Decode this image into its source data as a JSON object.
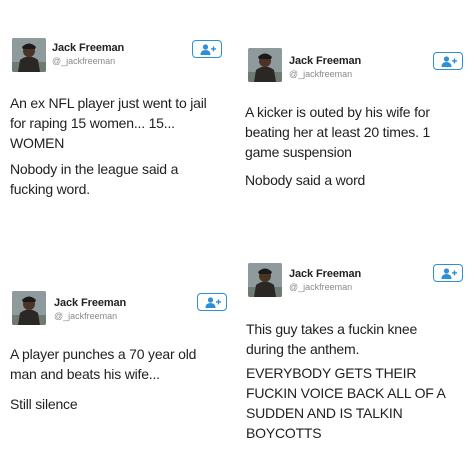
{
  "tweets": [
    {
      "name": "Jack Freeman",
      "handle": "@_jackfreeman",
      "paragraphs": [
        "An ex NFL player just went to jail\nfor raping 15 women... 15...\nWOMEN",
        "Nobody in the league said a\nfucking word."
      ]
    },
    {
      "name": "Jack Freeman",
      "handle": "@_jackfreeman",
      "paragraphs": [
        "A kicker is outed by his wife for\nbeating her at least 20 times. 1\ngame suspension",
        "Nobody said a word"
      ]
    },
    {
      "name": "Jack Freeman",
      "handle": "@_jackfreeman",
      "paragraphs": [
        "A player punches a 70 year old\nman and beats his wife...",
        "Still silence"
      ]
    },
    {
      "name": "Jack Freeman",
      "handle": "@_jackfreeman",
      "paragraphs": [
        "This guy takes a fuckin knee\nduring the anthem.",
        "EVERYBODY GETS THEIR\nFUCKIN VOICE BACK ALL OF A\nSUDDEN AND IS TALKIN\nBOYCOTTS"
      ]
    }
  ],
  "icons": {
    "follow": "add-user-icon",
    "avatar": "profile-photo"
  },
  "colors": {
    "follow_border": "#2f8fd6",
    "handle": "#8a8a8a",
    "text": "#1f1f1f"
  }
}
